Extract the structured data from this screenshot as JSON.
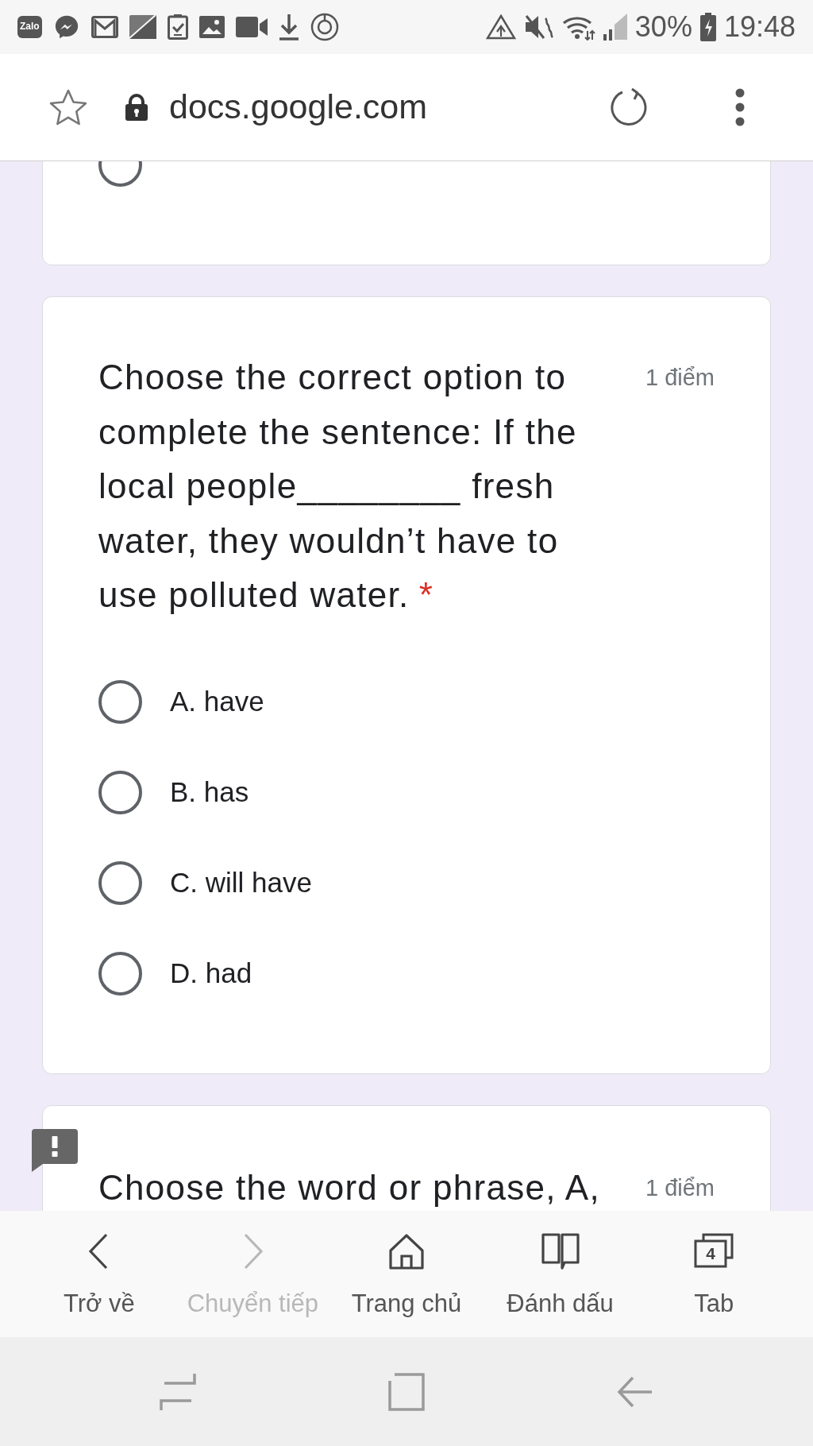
{
  "status_bar": {
    "app_badge": "Zalo",
    "battery": "30%",
    "time": "19:48"
  },
  "browser_bar": {
    "url": "docs.google.com",
    "secure": true
  },
  "previous_question": {
    "options": [
      {
        "selected": false
      }
    ]
  },
  "question": {
    "text": "Choose the correct option to complete the sentence: If the local people________ fresh water, they wouldn’t have to use polluted water.",
    "required_mark": "*",
    "points": "1 điểm",
    "options": [
      {
        "label": "A. have",
        "selected": false
      },
      {
        "label": "B. has",
        "selected": false
      },
      {
        "label": "C. will have",
        "selected": false
      },
      {
        "label": "D. had",
        "selected": false
      }
    ]
  },
  "next_question": {
    "text": "Choose the word or phrase, A,",
    "points": "1 điểm",
    "flagged": true
  },
  "bottom_nav": [
    {
      "kind": "back",
      "label": "Trở về",
      "disabled": false
    },
    {
      "kind": "forward",
      "label": "Chuyển tiếp",
      "disabled": true
    },
    {
      "kind": "home",
      "label": "Trang chủ",
      "disabled": false
    },
    {
      "kind": "bookmarks",
      "label": "Đánh dấu",
      "disabled": false
    },
    {
      "kind": "tabs",
      "label": "Tab",
      "disabled": false,
      "count": "4"
    }
  ]
}
